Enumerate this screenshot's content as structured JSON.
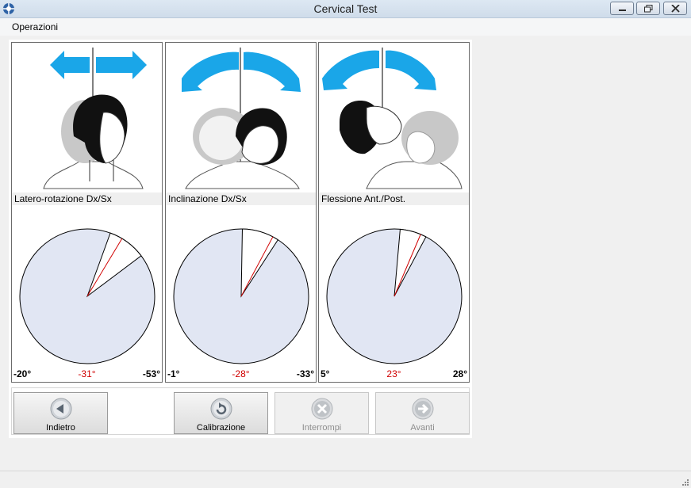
{
  "window": {
    "title": "Cervical Test"
  },
  "menu": {
    "items": [
      "Operazioni"
    ]
  },
  "panels": [
    {
      "label": "Latero-rotazione Dx/Sx",
      "left": "-20°",
      "mid": "-31°",
      "right": "-53°",
      "gauge_angles_deg": [
        20,
        31,
        53
      ]
    },
    {
      "label": "Inclinazione Dx/Sx",
      "left": "-1°",
      "mid": "-28°",
      "right": "-33°",
      "gauge_angles_deg": [
        1,
        28,
        33
      ]
    },
    {
      "label": "Flessione Ant./Post.",
      "left": "5°",
      "mid": "23°",
      "right": "28°",
      "gauge_angles_deg": [
        5,
        23,
        28
      ]
    }
  ],
  "buttons": {
    "back": "Indietro",
    "calibration": "Calibrazione",
    "stop": "Interrompi",
    "next": "Avanti"
  },
  "colors": {
    "accent_arrow": "#1aa6e8",
    "gauge_fill": "#e1e6f3",
    "mid_value": "#d00000"
  }
}
